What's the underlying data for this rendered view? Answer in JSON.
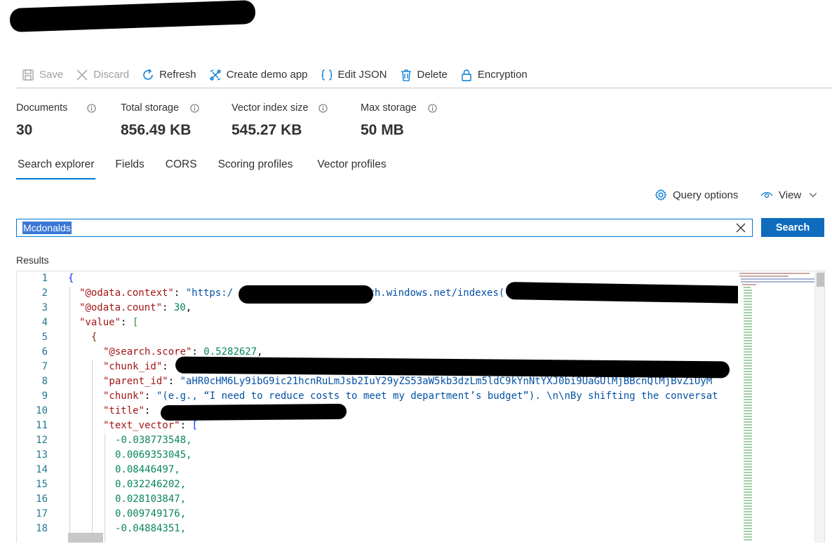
{
  "toolbar": {
    "save": "Save",
    "discard": "Discard",
    "refresh": "Refresh",
    "create_demo_app": "Create demo app",
    "edit_json": "Edit JSON",
    "delete": "Delete",
    "encryption": "Encryption"
  },
  "stats": [
    {
      "label": "Documents",
      "value": "30"
    },
    {
      "label": "Total storage",
      "value": "856.49 KB"
    },
    {
      "label": "Vector index size",
      "value": "545.27 KB"
    },
    {
      "label": "Max storage",
      "value": "50 MB"
    }
  ],
  "tabs": [
    "Search explorer",
    "Fields",
    "CORS",
    "Scoring profiles",
    "Vector profiles"
  ],
  "active_tab": "Search explorer",
  "query_options": "Query options",
  "view": "View",
  "search": {
    "value": "Mcdonalds",
    "button": "Search"
  },
  "results_label": "Results",
  "editor": {
    "line_numbers": [
      "1",
      "2",
      "3",
      "4",
      "5",
      "6",
      "7",
      "8",
      "9",
      "10",
      "11",
      "12",
      "13",
      "14",
      "15",
      "16",
      "17",
      "18"
    ],
    "lines": {
      "l1_brace": "{",
      "l2_key": "\"@odata.context\"",
      "l2_val_start": "\"https:/",
      "l2_val_mid": "earch.windows.net/indexes(",
      "l3_key": "\"@odata.count\"",
      "l3_val": "30",
      "l4_key": "\"value\"",
      "l4_bracket": "[",
      "l5_brace": "{",
      "l6_key": "\"@search.score\"",
      "l6_val": "0.5282627",
      "l7_key": "\"chunk_id\"",
      "l8_key": "\"parent_id\"",
      "l8_val": "\"aHR0cHM6Ly9ibG9ic21hcnRuLmJsb2IuY29yZS53aW5kb3dzLm5ldC9kYnNtYXJ0bi9UaGUlMjBBcnQlMjBvZiUyM",
      "l9_key": "\"chunk\"",
      "l9_val": "\"(e.g., “I need to reduce costs to meet my department’s budget”). \\n\\nBy shifting the conversat",
      "l10_key": "\"title\"",
      "l11_key": "\"text_vector\"",
      "l11_bracket": "[",
      "vector": [
        "-0.038773548,",
        "0.0069353045,",
        "0.08446497,",
        "0.032246202,",
        "0.028103847,",
        "0.009749176,",
        "-0.04884351,"
      ]
    }
  },
  "colors": {
    "accent": "#0078d4",
    "button": "#0f6cbd",
    "json_key": "#a31515",
    "json_string": "#0451a5",
    "json_number": "#098658",
    "line_number": "#237893"
  }
}
